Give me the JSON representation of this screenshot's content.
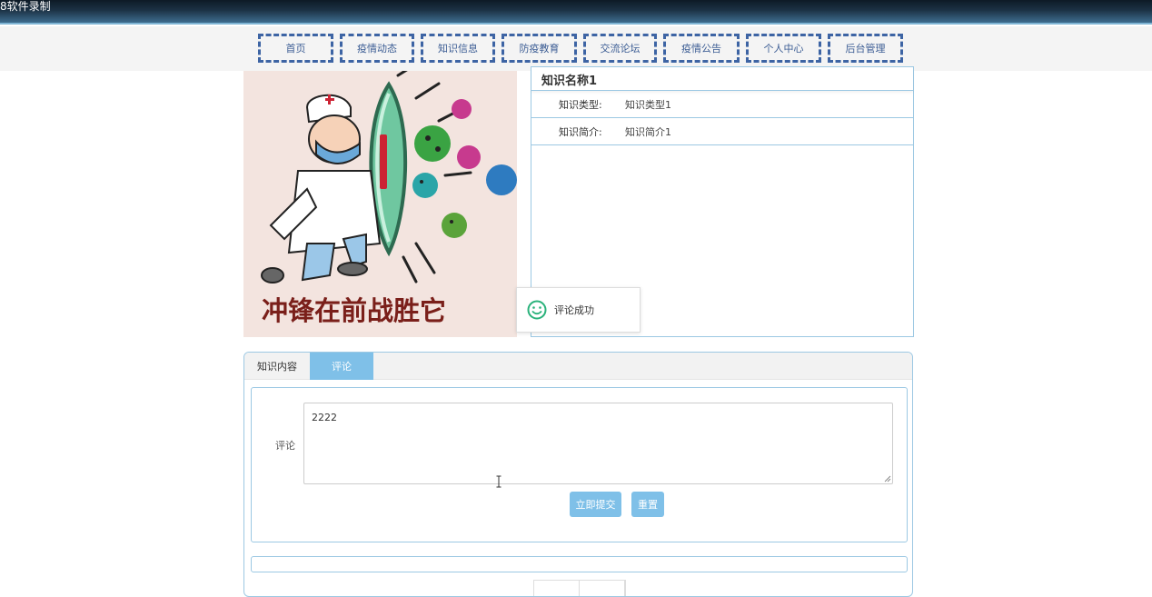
{
  "recorder": {
    "text": "8软件录制"
  },
  "nav": [
    {
      "label": "首页"
    },
    {
      "label": "疫情动态"
    },
    {
      "label": "知识信息"
    },
    {
      "label": "防疫教育"
    },
    {
      "label": "交流论坛"
    },
    {
      "label": "疫情公告"
    },
    {
      "label": "个人中心"
    },
    {
      "label": "后台管理"
    }
  ],
  "poster": {
    "slogan": "冲锋在前战胜它"
  },
  "detail": {
    "title": "知识名称1",
    "type_label": "知识类型:",
    "type_value": "知识类型1",
    "intro_label": "知识简介:",
    "intro_value": "知识简介1"
  },
  "toast": {
    "text": "评论成功",
    "icon": "smile-icon"
  },
  "tabs": [
    {
      "label": "知识内容"
    },
    {
      "label": "评论"
    }
  ],
  "comment_form": {
    "label": "评论",
    "value": "2222",
    "submit_label": "立即提交",
    "reset_label": "重置"
  },
  "colors": {
    "accent": "#7fc0e8",
    "nav_border": "#3d64a4",
    "panel_border": "#9cc8e3"
  }
}
